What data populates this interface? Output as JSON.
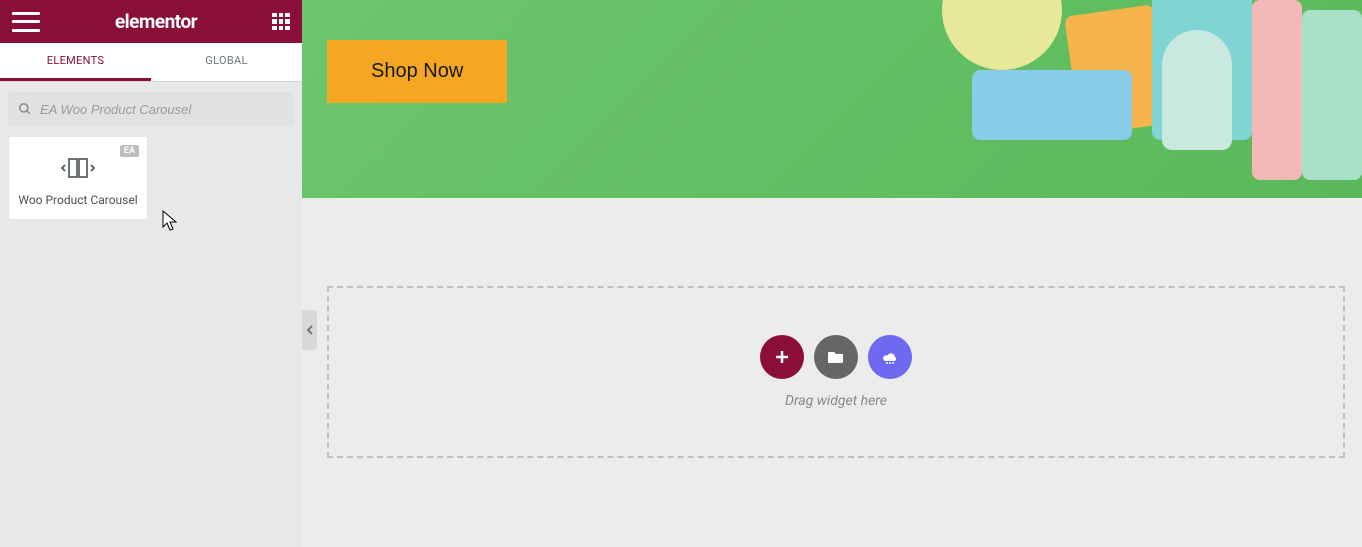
{
  "sidebar": {
    "logo": "elementor",
    "tabs": {
      "elements": "ELEMENTS",
      "global": "GLOBAL"
    },
    "search_placeholder": "EA Woo Product Carousel",
    "widget": {
      "badge": "EA",
      "label": "Woo Product Carousel"
    }
  },
  "hero": {
    "cta": "Shop Now"
  },
  "dropzone": {
    "hint": "Drag widget here"
  }
}
